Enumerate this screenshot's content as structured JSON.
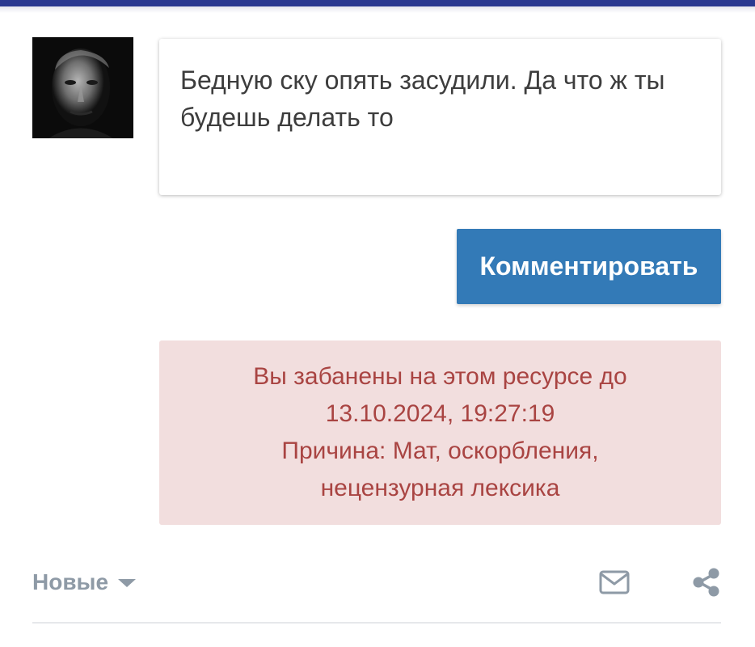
{
  "comment_form": {
    "text": "Бедную ску опять засудили. Да что ж ты будешь делать то",
    "submit_label": "Комментировать"
  },
  "ban_notice": {
    "line1": "Вы забанены на этом ресурсе до",
    "line2": "13.10.2024, 19:27:19",
    "line3": "Причина: Мат, оскорбления,",
    "line4": "нецензурная лексика"
  },
  "toolbar": {
    "sort_label": "Новые",
    "subscribe_icon": "envelope-icon",
    "share_icon": "share-icon"
  },
  "colors": {
    "topbar": "#2b3990",
    "button": "#337ab7",
    "alert_bg": "#f2dede",
    "alert_text": "#a94442",
    "muted": "#8e9aa6"
  }
}
